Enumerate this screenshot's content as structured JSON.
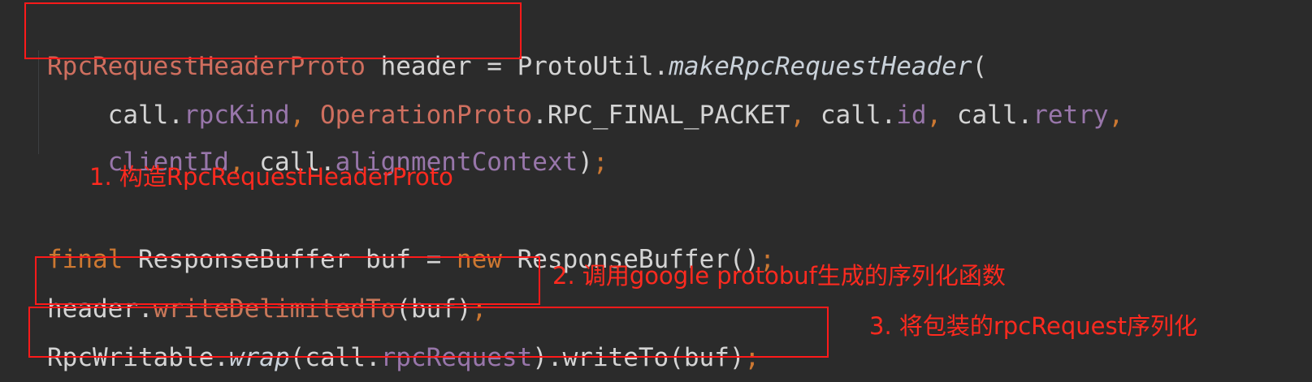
{
  "code": {
    "line1": {
      "type": "RpcRequestHeaderProto",
      "var": " header",
      "assign": " = ProtoUtil.",
      "method": "makeRpcRequestHeader",
      "open": "("
    },
    "line2": {
      "indent": "    ",
      "t1": "call.",
      "f1": "rpcKind",
      "c1": ", ",
      "cls": "OperationProto",
      "t2": ".RPC_FINAL_PACKET",
      "c2": ", ",
      "t3": "call.",
      "f2": "id",
      "c3": ", ",
      "t4": "call.",
      "f3": "retry",
      "c4": ","
    },
    "line3": {
      "indent": "    ",
      "f1": "clientId",
      "c1": ", ",
      "t1": "call.",
      "f2": "alignmentContext",
      "close": ")",
      "semi": ";"
    },
    "line4": {
      "kw1": "final",
      "t1": " ResponseBuffer buf = ",
      "kw2": "new",
      "t2": " ResponseBuffer()",
      "semi": ";"
    },
    "line5": {
      "t1": "header.",
      "m1": "writeDelimitedTo",
      "t2": "(buf)",
      "semi": ";"
    },
    "line6": {
      "t1": "RpcWritable.",
      "m1": "wrap",
      "t2": "(call.",
      "f1": "rpcRequest",
      "t3": ").writeTo(buf)",
      "semi": ";"
    }
  },
  "annotations": {
    "a1": "1. 构造RpcRequestHeaderProto",
    "a2": "2. 调用google protobuf生成的序列化函数",
    "a3": "3. 将包装的rpcRequest序列化"
  },
  "colors": {
    "background": "#2b2b2b",
    "annotation": "#ff2a1f",
    "box_border": "#ff1a1a"
  }
}
